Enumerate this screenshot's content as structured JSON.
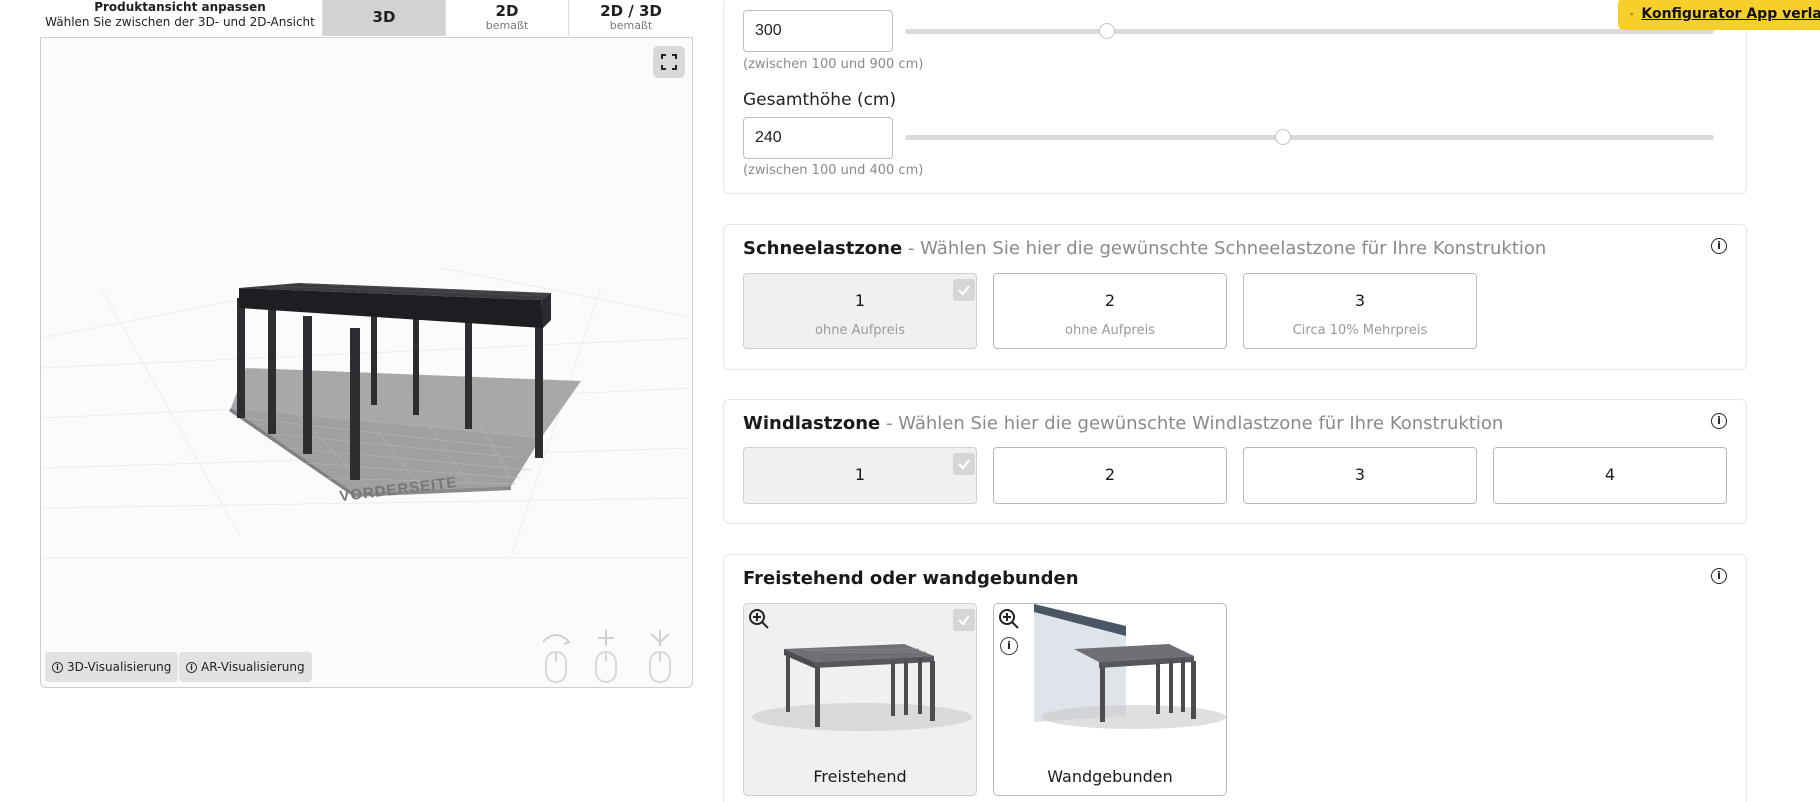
{
  "viewer": {
    "title": "Produktansicht anpassen",
    "subtitle": "Wählen Sie zwischen der 3D- und 2D-Ansicht",
    "tabs": [
      {
        "label": "3D",
        "sub": ""
      },
      {
        "label": "2D",
        "sub": "bemaßt"
      },
      {
        "label": "2D / 3D",
        "sub": "bemaßt"
      }
    ],
    "active_tab": "3D",
    "floor_label": "VORDERSEITE",
    "buttons": {
      "viz3d": "3D-Visualisierung",
      "ar": "AR-Visualisierung"
    }
  },
  "dimensions": {
    "depth": {
      "value": "300",
      "hint": "(zwischen 100 und 900 cm)",
      "min": 100,
      "max": 900
    },
    "height": {
      "label": "Gesamthöhe (cm)",
      "value": "240",
      "hint": "(zwischen 100 und 400 cm)",
      "min": 100,
      "max": 400
    }
  },
  "snow": {
    "title": "Schneelastzone",
    "desc": "- Wählen Sie hier die gewünschte Schneelastzone für Ihre Konstruktion",
    "options": [
      {
        "value": "1",
        "sub": "ohne Aufpreis",
        "selected": true
      },
      {
        "value": "2",
        "sub": "ohne Aufpreis",
        "selected": false
      },
      {
        "value": "3",
        "sub": "Circa 10% Mehrpreis",
        "selected": false
      }
    ]
  },
  "wind": {
    "title": "Windlastzone",
    "desc": "- Wählen Sie hier die gewünschte Windlastzone für Ihre Konstruktion",
    "options": [
      {
        "value": "1",
        "selected": true
      },
      {
        "value": "2",
        "selected": false
      },
      {
        "value": "3",
        "selected": false
      },
      {
        "value": "4",
        "selected": false
      }
    ]
  },
  "mount": {
    "title": "Freistehend oder wandgebunden",
    "options": [
      {
        "label": "Freistehend",
        "selected": true
      },
      {
        "label": "Wandgebunden",
        "selected": false
      }
    ]
  },
  "exit": {
    "label": "Konfigurator App verlassen"
  },
  "icons": [
    "expand-icon",
    "info-icon",
    "check-icon",
    "zoom-in-icon",
    "close-icon",
    "mouse-rotate-icon",
    "mouse-pan-icon",
    "mouse-zoom-icon"
  ],
  "colors": {
    "accent": "#f7cf2b",
    "selected_bg": "#f0f0f0",
    "frame": "#2c2e31"
  }
}
